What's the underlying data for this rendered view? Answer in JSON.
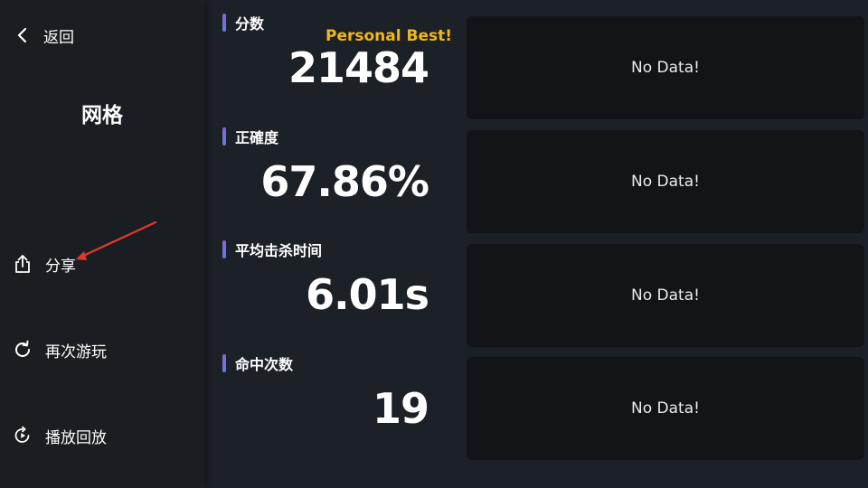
{
  "sidebar": {
    "back_label": "返回",
    "mode_title": "网格",
    "items": [
      {
        "label": "分享",
        "icon": "share-icon"
      },
      {
        "label": "再次游玩",
        "icon": "replay-icon"
      },
      {
        "label": "播放回放",
        "icon": "playback-icon"
      }
    ]
  },
  "stats": [
    {
      "label": "分数",
      "value": "21484"
    },
    {
      "label": "正確度",
      "value": "67.86%"
    },
    {
      "label": "平均击杀时间",
      "value": "6.01s"
    },
    {
      "label": "命中次数",
      "value": "19"
    }
  ],
  "personal_best": "Personal Best!",
  "panels": [
    {
      "text": "No Data!"
    },
    {
      "text": "No Data!"
    },
    {
      "text": "No Data!"
    },
    {
      "text": "No Data!"
    }
  ],
  "colors": {
    "accent_gold": "#f2b718",
    "annotation_arrow": "#e0392b",
    "label_bar_top": "#8a63d2",
    "label_bar_bottom": "#5b7de8"
  }
}
